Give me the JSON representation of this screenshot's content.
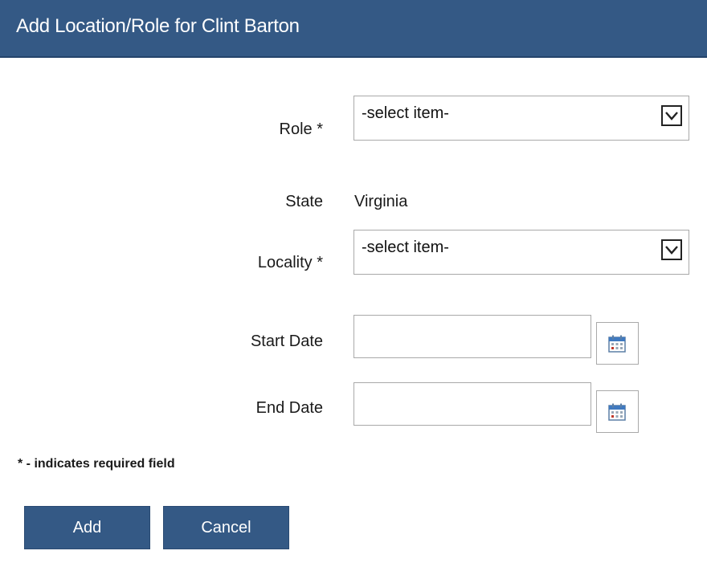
{
  "dialog": {
    "title": "Add Location/Role for Clint Barton"
  },
  "form": {
    "role": {
      "label": "Role *",
      "value": "-select item-"
    },
    "state": {
      "label": "State",
      "value": "Virginia"
    },
    "locality": {
      "label": "Locality *",
      "value": "-select item-"
    },
    "start_date": {
      "label": "Start Date",
      "value": ""
    },
    "end_date": {
      "label": "End Date",
      "value": ""
    },
    "required_note": "* - indicates required field"
  },
  "buttons": {
    "add": "Add",
    "cancel": "Cancel"
  },
  "icons": {
    "dropdown": "chevron-down-icon",
    "calendar": "calendar-icon"
  },
  "colors": {
    "accent": "#345985",
    "text": "#1a1a1a",
    "border": "#a9a9a9"
  }
}
